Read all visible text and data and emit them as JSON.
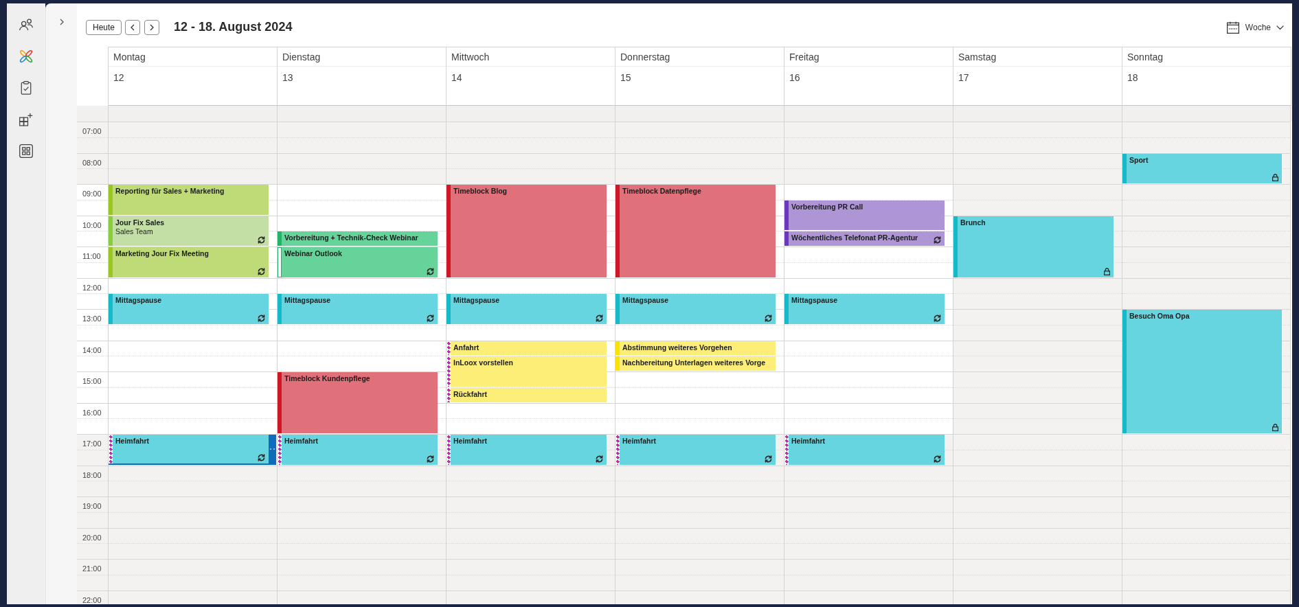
{
  "toolbar": {
    "today_button": "Heute",
    "date_range": "12 - 18. August 2024",
    "view": "Woche"
  },
  "hours": [
    {
      "label": "07:00",
      "working": false
    },
    {
      "label": "08:00",
      "working": false
    },
    {
      "label": "09:00",
      "working": true
    },
    {
      "label": "10:00",
      "working": true
    },
    {
      "label": "11:00",
      "working": true
    },
    {
      "label": "12:00",
      "working": true
    },
    {
      "label": "13:00",
      "working": true
    },
    {
      "label": "14:00",
      "working": true
    },
    {
      "label": "15:00",
      "working": true
    },
    {
      "label": "16:00",
      "working": true
    },
    {
      "label": "17:00",
      "working": false
    },
    {
      "label": "18:00",
      "working": false
    },
    {
      "label": "19:00",
      "working": false
    },
    {
      "label": "20:00",
      "working": false
    },
    {
      "label": "21:00",
      "working": false
    },
    {
      "label": "22:00",
      "working": false
    }
  ],
  "days": [
    {
      "weekday": "Montag",
      "date": "12",
      "workday": true,
      "slots": [
        {
          "kind": "empty"
        },
        {
          "kind": "empty"
        },
        {
          "kind": "empty"
        },
        {
          "kind": "empty"
        },
        {
          "kind": "event",
          "title": "Reporting für Sales + Marketing",
          "color": "#bfdb77",
          "working_elsewhere": false,
          "show_as_free": false,
          "recurring": false,
          "private": false,
          "selected": false
        },
        {
          "kind": "continued"
        },
        {
          "kind": "event",
          "title": "Jour Fix Sales",
          "subtitle": "Sales Team",
          "color": "#c4dfa6",
          "working_elsewhere": false,
          "show_as_free": false,
          "recurring": true,
          "private": false,
          "selected": false
        },
        {
          "kind": "continued"
        },
        {
          "kind": "event",
          "title": "Marketing Jour Fix Meeting",
          "color": "#bfdb77",
          "working_elsewhere": false,
          "show_as_free": false,
          "recurring": true,
          "private": false,
          "selected": false
        },
        {
          "kind": "continued"
        },
        {
          "kind": "empty"
        },
        {
          "kind": "event",
          "title": "Mittagspause",
          "color": "#67d5df",
          "working_elsewhere": false,
          "show_as_free": false,
          "recurring": true,
          "private": false,
          "selected": false
        },
        {
          "kind": "continued"
        },
        {
          "kind": "empty"
        },
        {
          "kind": "empty"
        },
        {
          "kind": "empty"
        },
        {
          "kind": "empty"
        },
        {
          "kind": "empty"
        },
        {
          "kind": "empty"
        },
        {
          "kind": "empty"
        },
        {
          "kind": "event",
          "title": "Heimfahrt",
          "color": "#67d5df",
          "working_elsewhere": true,
          "show_as_free": false,
          "recurring": true,
          "private": false,
          "selected": true
        },
        {
          "kind": "continued"
        },
        {
          "kind": "empty"
        },
        {
          "kind": "empty"
        },
        {
          "kind": "empty"
        },
        {
          "kind": "empty"
        },
        {
          "kind": "empty"
        },
        {
          "kind": "empty"
        },
        {
          "kind": "empty"
        },
        {
          "kind": "empty"
        },
        {
          "kind": "empty"
        }
      ]
    },
    {
      "weekday": "Dienstag",
      "date": "13",
      "workday": true,
      "slots": [
        {
          "kind": "empty"
        },
        {
          "kind": "empty"
        },
        {
          "kind": "empty"
        },
        {
          "kind": "empty"
        },
        {
          "kind": "empty"
        },
        {
          "kind": "empty"
        },
        {
          "kind": "empty"
        },
        {
          "kind": "event",
          "title": "Vorbereitung + Technik-Check Webinar",
          "color": "#66d39b",
          "working_elsewhere": false,
          "show_as_free": false,
          "recurring": false,
          "private": false,
          "selected": false
        },
        {
          "kind": "event",
          "title": "Webinar Outlook",
          "color": "#66d39b",
          "working_elsewhere": false,
          "show_as_free": true,
          "recurring": true,
          "private": false,
          "selected": false
        },
        {
          "kind": "continued"
        },
        {
          "kind": "empty"
        },
        {
          "kind": "event",
          "title": "Mittagspause",
          "color": "#67d5df",
          "working_elsewhere": false,
          "show_as_free": false,
          "recurring": true,
          "private": false,
          "selected": false
        },
        {
          "kind": "continued"
        },
        {
          "kind": "empty"
        },
        {
          "kind": "empty"
        },
        {
          "kind": "empty"
        },
        {
          "kind": "event",
          "title": "Timeblock Kundenpflege",
          "color": "#e0717b",
          "working_elsewhere": false,
          "show_as_free": false,
          "recurring": false,
          "private": false,
          "selected": false
        },
        {
          "kind": "continued"
        },
        {
          "kind": "continued"
        },
        {
          "kind": "continued"
        },
        {
          "kind": "event",
          "title": "Heimfahrt",
          "color": "#67d5df",
          "working_elsewhere": true,
          "show_as_free": false,
          "recurring": true,
          "private": false,
          "selected": false
        },
        {
          "kind": "continued"
        },
        {
          "kind": "empty"
        },
        {
          "kind": "empty"
        },
        {
          "kind": "empty"
        },
        {
          "kind": "empty"
        },
        {
          "kind": "empty"
        },
        {
          "kind": "empty"
        },
        {
          "kind": "empty"
        },
        {
          "kind": "empty"
        },
        {
          "kind": "empty"
        }
      ]
    },
    {
      "weekday": "Mittwoch",
      "date": "14",
      "workday": true,
      "slots": [
        {
          "kind": "empty"
        },
        {
          "kind": "empty"
        },
        {
          "kind": "empty"
        },
        {
          "kind": "empty"
        },
        {
          "kind": "event",
          "title": "Timeblock Blog",
          "color": "#e0717b",
          "working_elsewhere": false,
          "show_as_free": false,
          "recurring": false,
          "private": false,
          "selected": false
        },
        {
          "kind": "continued"
        },
        {
          "kind": "continued"
        },
        {
          "kind": "continued"
        },
        {
          "kind": "continued"
        },
        {
          "kind": "continued"
        },
        {
          "kind": "empty"
        },
        {
          "kind": "event",
          "title": "Mittagspause",
          "color": "#67d5df",
          "working_elsewhere": false,
          "show_as_free": false,
          "recurring": true,
          "private": false,
          "selected": false
        },
        {
          "kind": "continued"
        },
        {
          "kind": "empty"
        },
        {
          "kind": "event",
          "title": "Anfahrt",
          "color": "#fdee78",
          "working_elsewhere": true,
          "show_as_free": false,
          "recurring": false,
          "private": false,
          "selected": false
        },
        {
          "kind": "event",
          "title": "InLoox vorstellen",
          "color": "#fdee78",
          "working_elsewhere": true,
          "show_as_free": false,
          "recurring": false,
          "private": false,
          "selected": false
        },
        {
          "kind": "continued"
        },
        {
          "kind": "event",
          "title": "Rückfahrt",
          "color": "#fdee78",
          "working_elsewhere": true,
          "show_as_free": false,
          "recurring": false,
          "private": false,
          "selected": false
        },
        {
          "kind": "empty"
        },
        {
          "kind": "empty"
        },
        {
          "kind": "event",
          "title": "Heimfahrt",
          "color": "#67d5df",
          "working_elsewhere": true,
          "show_as_free": false,
          "recurring": true,
          "private": false,
          "selected": false
        },
        {
          "kind": "continued"
        },
        {
          "kind": "empty"
        },
        {
          "kind": "empty"
        },
        {
          "kind": "empty"
        },
        {
          "kind": "empty"
        },
        {
          "kind": "empty"
        },
        {
          "kind": "empty"
        },
        {
          "kind": "empty"
        },
        {
          "kind": "empty"
        },
        {
          "kind": "empty"
        }
      ]
    },
    {
      "weekday": "Donnerstag",
      "date": "15",
      "workday": true,
      "slots": [
        {
          "kind": "empty"
        },
        {
          "kind": "empty"
        },
        {
          "kind": "empty"
        },
        {
          "kind": "empty"
        },
        {
          "kind": "event",
          "title": "Timeblock Datenpflege",
          "color": "#e0717b",
          "working_elsewhere": false,
          "show_as_free": false,
          "recurring": false,
          "private": false,
          "selected": false
        },
        {
          "kind": "continued"
        },
        {
          "kind": "continued"
        },
        {
          "kind": "continued"
        },
        {
          "kind": "continued"
        },
        {
          "kind": "continued"
        },
        {
          "kind": "empty"
        },
        {
          "kind": "event",
          "title": "Mittagspause",
          "color": "#67d5df",
          "working_elsewhere": false,
          "show_as_free": false,
          "recurring": true,
          "private": false,
          "selected": false
        },
        {
          "kind": "continued"
        },
        {
          "kind": "empty"
        },
        {
          "kind": "event",
          "title": "Abstimmung weiteres Vorgehen",
          "color": "#fdee78",
          "working_elsewhere": false,
          "show_as_free": false,
          "recurring": false,
          "private": false,
          "selected": false
        },
        {
          "kind": "event",
          "title": "Nachbereitung Unterlagen weiteres Vorge",
          "color": "#fdee78",
          "working_elsewhere": false,
          "show_as_free": false,
          "recurring": false,
          "private": false,
          "selected": false
        },
        {
          "kind": "empty"
        },
        {
          "kind": "empty"
        },
        {
          "kind": "empty"
        },
        {
          "kind": "empty"
        },
        {
          "kind": "event",
          "title": "Heimfahrt",
          "color": "#67d5df",
          "working_elsewhere": true,
          "show_as_free": false,
          "recurring": true,
          "private": false,
          "selected": false
        },
        {
          "kind": "continued"
        },
        {
          "kind": "empty"
        },
        {
          "kind": "empty"
        },
        {
          "kind": "empty"
        },
        {
          "kind": "empty"
        },
        {
          "kind": "empty"
        },
        {
          "kind": "empty"
        },
        {
          "kind": "empty"
        },
        {
          "kind": "empty"
        },
        {
          "kind": "empty"
        }
      ]
    },
    {
      "weekday": "Freitag",
      "date": "16",
      "workday": true,
      "slots": [
        {
          "kind": "empty"
        },
        {
          "kind": "empty"
        },
        {
          "kind": "empty"
        },
        {
          "kind": "empty"
        },
        {
          "kind": "empty"
        },
        {
          "kind": "event",
          "title": "Vorbereitung PR Call",
          "color": "#ae96d6",
          "working_elsewhere": false,
          "show_as_free": false,
          "recurring": false,
          "private": false,
          "selected": false
        },
        {
          "kind": "continued"
        },
        {
          "kind": "event",
          "title": "Wöchentliches Telefonat PR-Agentur",
          "color": "#ae96d6",
          "working_elsewhere": false,
          "show_as_free": false,
          "recurring": true,
          "private": false,
          "selected": false
        },
        {
          "kind": "empty"
        },
        {
          "kind": "empty"
        },
        {
          "kind": "empty"
        },
        {
          "kind": "event",
          "title": "Mittagspause",
          "color": "#67d5df",
          "working_elsewhere": false,
          "show_as_free": false,
          "recurring": true,
          "private": false,
          "selected": false
        },
        {
          "kind": "continued"
        },
        {
          "kind": "empty"
        },
        {
          "kind": "empty"
        },
        {
          "kind": "empty"
        },
        {
          "kind": "empty"
        },
        {
          "kind": "empty"
        },
        {
          "kind": "empty"
        },
        {
          "kind": "empty"
        },
        {
          "kind": "event",
          "title": "Heimfahrt",
          "color": "#67d5df",
          "working_elsewhere": true,
          "show_as_free": false,
          "recurring": true,
          "private": false,
          "selected": false
        },
        {
          "kind": "continued"
        },
        {
          "kind": "empty"
        },
        {
          "kind": "empty"
        },
        {
          "kind": "empty"
        },
        {
          "kind": "empty"
        },
        {
          "kind": "empty"
        },
        {
          "kind": "empty"
        },
        {
          "kind": "empty"
        },
        {
          "kind": "empty"
        },
        {
          "kind": "empty"
        }
      ]
    },
    {
      "weekday": "Samstag",
      "date": "17",
      "workday": false,
      "slots": [
        {
          "kind": "empty"
        },
        {
          "kind": "empty"
        },
        {
          "kind": "empty"
        },
        {
          "kind": "empty"
        },
        {
          "kind": "empty"
        },
        {
          "kind": "empty"
        },
        {
          "kind": "event",
          "title": "Brunch",
          "color": "#67d5df",
          "working_elsewhere": false,
          "show_as_free": false,
          "recurring": false,
          "private": true,
          "selected": false
        },
        {
          "kind": "continued"
        },
        {
          "kind": "continued"
        },
        {
          "kind": "continued"
        },
        {
          "kind": "empty"
        },
        {
          "kind": "empty"
        },
        {
          "kind": "empty"
        },
        {
          "kind": "empty"
        },
        {
          "kind": "empty"
        },
        {
          "kind": "empty"
        },
        {
          "kind": "empty"
        },
        {
          "kind": "empty"
        },
        {
          "kind": "empty"
        },
        {
          "kind": "empty"
        },
        {
          "kind": "empty"
        },
        {
          "kind": "empty"
        },
        {
          "kind": "empty"
        },
        {
          "kind": "empty"
        },
        {
          "kind": "empty"
        },
        {
          "kind": "empty"
        },
        {
          "kind": "empty"
        },
        {
          "kind": "empty"
        },
        {
          "kind": "empty"
        },
        {
          "kind": "empty"
        },
        {
          "kind": "empty"
        }
      ]
    },
    {
      "weekday": "Sonntag",
      "date": "18",
      "workday": false,
      "slots": [
        {
          "kind": "empty"
        },
        {
          "kind": "empty"
        },
        {
          "kind": "event",
          "title": "Sport",
          "color": "#67d5df",
          "working_elsewhere": false,
          "show_as_free": false,
          "recurring": false,
          "private": true,
          "selected": false
        },
        {
          "kind": "continued"
        },
        {
          "kind": "empty"
        },
        {
          "kind": "empty"
        },
        {
          "kind": "empty"
        },
        {
          "kind": "empty"
        },
        {
          "kind": "empty"
        },
        {
          "kind": "empty"
        },
        {
          "kind": "empty"
        },
        {
          "kind": "empty"
        },
        {
          "kind": "event",
          "title": "Besuch Oma Opa",
          "color": "#67d5df",
          "working_elsewhere": false,
          "show_as_free": false,
          "recurring": false,
          "private": true,
          "selected": false
        },
        {
          "kind": "continued"
        },
        {
          "kind": "continued"
        },
        {
          "kind": "continued"
        },
        {
          "kind": "continued"
        },
        {
          "kind": "continued"
        },
        {
          "kind": "continued"
        },
        {
          "kind": "continued"
        },
        {
          "kind": "empty"
        },
        {
          "kind": "empty"
        },
        {
          "kind": "empty"
        },
        {
          "kind": "empty"
        },
        {
          "kind": "empty"
        },
        {
          "kind": "empty"
        },
        {
          "kind": "empty"
        },
        {
          "kind": "empty"
        },
        {
          "kind": "empty"
        },
        {
          "kind": "empty"
        },
        {
          "kind": "empty"
        }
      ]
    }
  ]
}
